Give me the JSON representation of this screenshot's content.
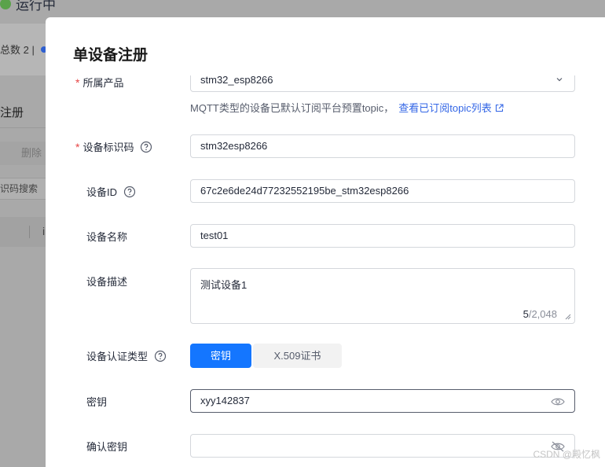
{
  "background": {
    "status_text": "运行中",
    "total_label": "总数 2 |",
    "register_label": "注册",
    "delete_label": "删除",
    "search_placeholder": "识码搜索",
    "table_header_fragment": "i"
  },
  "modal": {
    "title": "单设备注册",
    "product": {
      "label": "所属产品",
      "value": "stm32_esp8266",
      "required": true
    },
    "hint": {
      "text": "MQTT类型的设备已默认订阅平台预置topic，",
      "link": "查看已订阅topic列表"
    },
    "device_identifier": {
      "label": "设备标识码",
      "value": "stm32esp8266",
      "required": true
    },
    "device_id": {
      "label": "设备ID",
      "value": "67c2e6de24d77232552195be_stm32esp8266"
    },
    "device_name": {
      "label": "设备名称",
      "value": "test01"
    },
    "device_description": {
      "label": "设备描述",
      "value": "测试设备1",
      "count_current": "5",
      "count_max": "/2,048"
    },
    "auth_type": {
      "label": "设备认证类型",
      "options": [
        "密钥",
        "X.509证书"
      ],
      "selected": "密钥"
    },
    "secret": {
      "label": "密钥",
      "value": "xyy142837"
    },
    "confirm_secret": {
      "label": "确认密钥",
      "value": ""
    }
  },
  "watermark": "CSDN @殿忆枫",
  "colors": {
    "accent": "#1476ff",
    "link": "#3366e6",
    "required": "#e64545",
    "overlay": "#a9a9a9"
  }
}
